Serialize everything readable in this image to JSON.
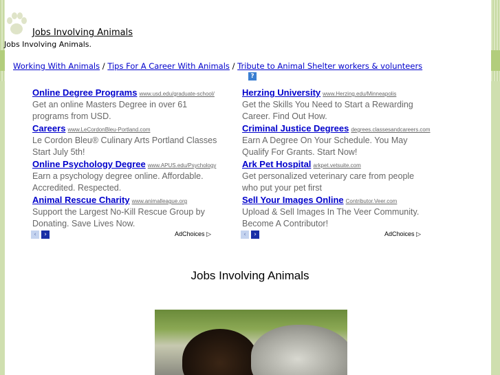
{
  "header": {
    "site_link": "Jobs Involving Animals",
    "tagline": "Jobs Involving Animals."
  },
  "breadcrumb": {
    "items": [
      "Working With Animals",
      "Tips For A Career With Animals",
      "Tribute to Animal Shelter workers & volunteers"
    ],
    "separator": "/"
  },
  "ads": {
    "help_label": "?",
    "left": [
      {
        "title": "Online Degree Programs",
        "url": "www.usd.edu/graduate-school/",
        "desc": "Get an online Masters Degree in over 61 programs from USD."
      },
      {
        "title": "Careers",
        "url": "www.LeCordonBleu-Portland.com",
        "desc": "Le Cordon Bleu® Culinary Arts Portland Classes Start July 5th!"
      },
      {
        "title": "Online Psychology Degree",
        "url": "www.APUS.edu/Psychology",
        "desc": "Earn a psychology degree online. Affordable. Accredited. Respected."
      },
      {
        "title": "Animal Rescue Charity",
        "url": "www.animalleague.org",
        "desc": "Support the Largest No-Kill Rescue Group by Donating. Save Lives Now."
      }
    ],
    "right": [
      {
        "title": "Herzing University",
        "url": "www.Herzing.edu/Minneapolis",
        "desc": "Get the Skills You Need to Start a Rewarding Career. Find Out How."
      },
      {
        "title": "Criminal Justice Degrees",
        "url": "degrees.classesandcareers.com",
        "desc": "Earn A Degree On Your Schedule. You May Qualify For Grants. Start Now!"
      },
      {
        "title": "Ark Pet Hospital",
        "url": "arkpet.vetsuite.com",
        "desc": "Get personalized veterinary care from people who put your pet first"
      },
      {
        "title": "Sell Your Images Online",
        "url": "Contributor.Veer.com",
        "desc": "Upload & Sell Images In The Veer Community. Become A Contributor!"
      }
    ],
    "adchoices_label": "AdChoices",
    "prev_glyph": "‹",
    "next_glyph": "›"
  },
  "main": {
    "title": "Jobs Involving Animals"
  },
  "colors": {
    "link": "#0000cc",
    "stripe": "#b2cd7c",
    "ad_text": "#666666"
  },
  "icons": {
    "logo": "paw-print-icon",
    "help": "help-icon"
  }
}
